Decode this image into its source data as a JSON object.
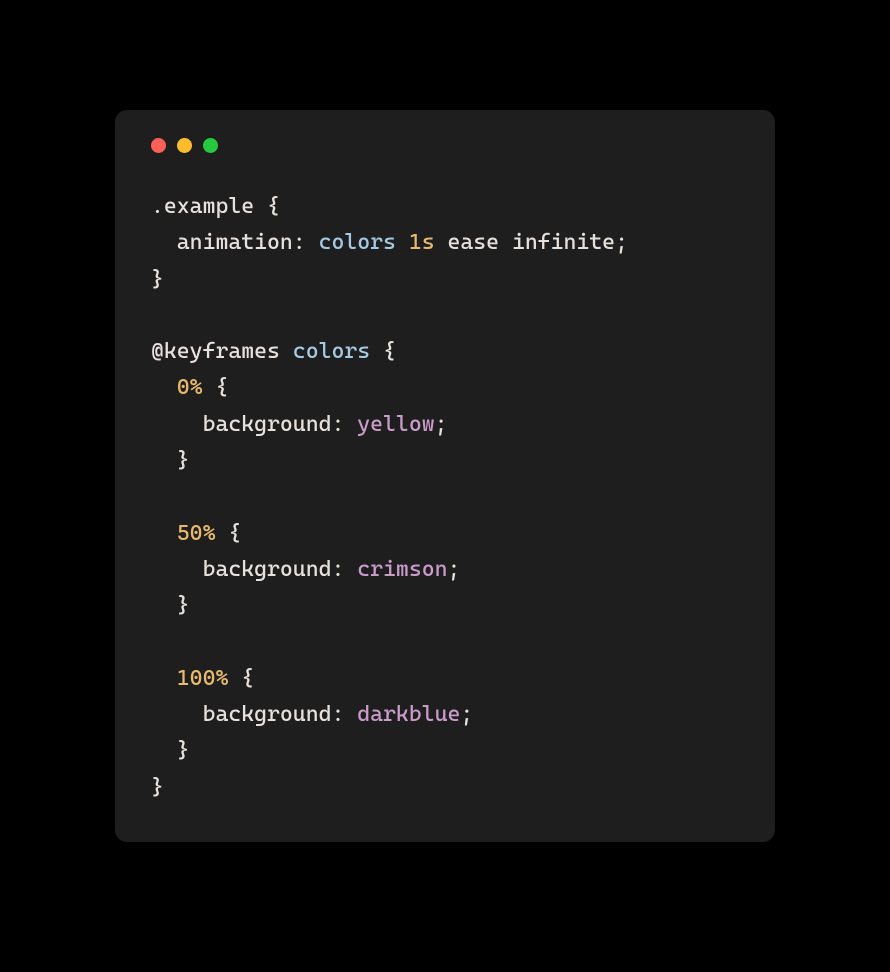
{
  "windowControls": {
    "close": "close",
    "minimize": "minimize",
    "maximize": "maximize"
  },
  "code": {
    "line1_selector": ".example",
    "line1_open": " {",
    "line2_indent": "  ",
    "line2_property": "animation",
    "line2_colon": ": ",
    "line2_name": "colors",
    "line2_space1": " ",
    "line2_duration": "1s",
    "line2_space2": " ",
    "line2_timing": "ease",
    "line2_space3": " ",
    "line2_iteration": "infinite",
    "line2_semi": ";",
    "line3_close": "}",
    "blank1": "",
    "line5_at": "@keyframes",
    "line5_space": " ",
    "line5_name": "colors",
    "line5_open": " {",
    "line6_indent": "  ",
    "line6_percent": "0%",
    "line6_open": " {",
    "line7_indent": "    ",
    "line7_property": "background",
    "line7_colon": ": ",
    "line7_value": "yellow",
    "line7_semi": ";",
    "line8_indent": "  ",
    "line8_close": "}",
    "blank2": "",
    "line10_indent": "  ",
    "line10_percent": "50%",
    "line10_open": " {",
    "line11_indent": "    ",
    "line11_property": "background",
    "line11_colon": ": ",
    "line11_value": "crimson",
    "line11_semi": ";",
    "line12_indent": "  ",
    "line12_close": "}",
    "blank3": "",
    "line14_indent": "  ",
    "line14_percent": "100%",
    "line14_open": " {",
    "line15_indent": "    ",
    "line15_property": "background",
    "line15_colon": ": ",
    "line15_value": "darkblue",
    "line15_semi": ";",
    "line16_indent": "  ",
    "line16_close": "}",
    "line17_close": "}"
  }
}
